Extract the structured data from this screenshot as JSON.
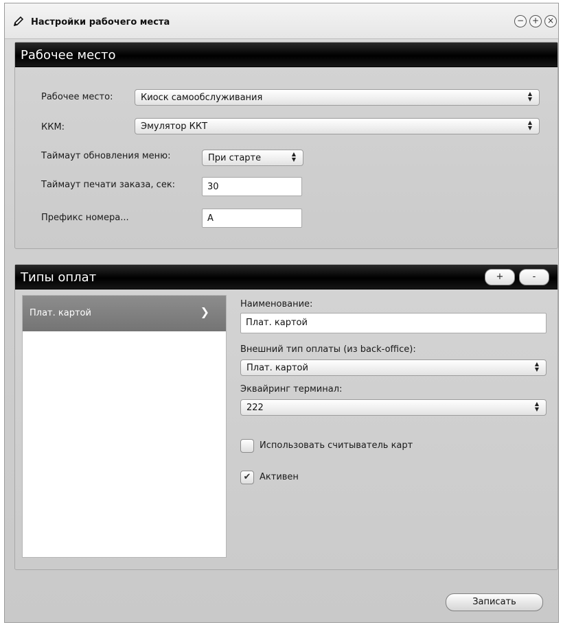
{
  "window": {
    "title": "Настройки рабочего места",
    "controls": {
      "minimize": "−",
      "maximize": "+",
      "close": "×"
    }
  },
  "workplace": {
    "header": "Рабочее место",
    "workplace_label": "Рабочее место:",
    "workplace_value": "Киоск самообслуживания",
    "kkm_label": "ККМ:",
    "kkm_value": "Эмулятор ККТ",
    "menu_timeout_label": "Таймаут обновления меню:",
    "menu_timeout_value": "При старте",
    "print_timeout_label": "Таймаут печати заказа, сек:",
    "print_timeout_value": "30",
    "prefix_label": "Префикс номера...",
    "prefix_value": "А"
  },
  "payments": {
    "header": "Типы оплат",
    "add_label": "+",
    "remove_label": "-",
    "items": [
      {
        "label": "Плат. картой"
      }
    ],
    "name_label": "Наименование:",
    "name_value": "Плат. картой",
    "external_type_label": "Внешний тип оплаты (из back-office):",
    "external_type_value": "Плат. картой",
    "acquiring_label": "Эквайринг терминал:",
    "acquiring_value": "222",
    "card_reader_label": "Использовать считыватель карт",
    "card_reader_checked": false,
    "active_label": "Активен",
    "active_checked": true
  },
  "footer": {
    "save_label": "Записать"
  },
  "icons": {
    "title": "pencil-icon",
    "list_chevron": "chevron-right-icon",
    "checkmark": "checkmark-icon"
  }
}
